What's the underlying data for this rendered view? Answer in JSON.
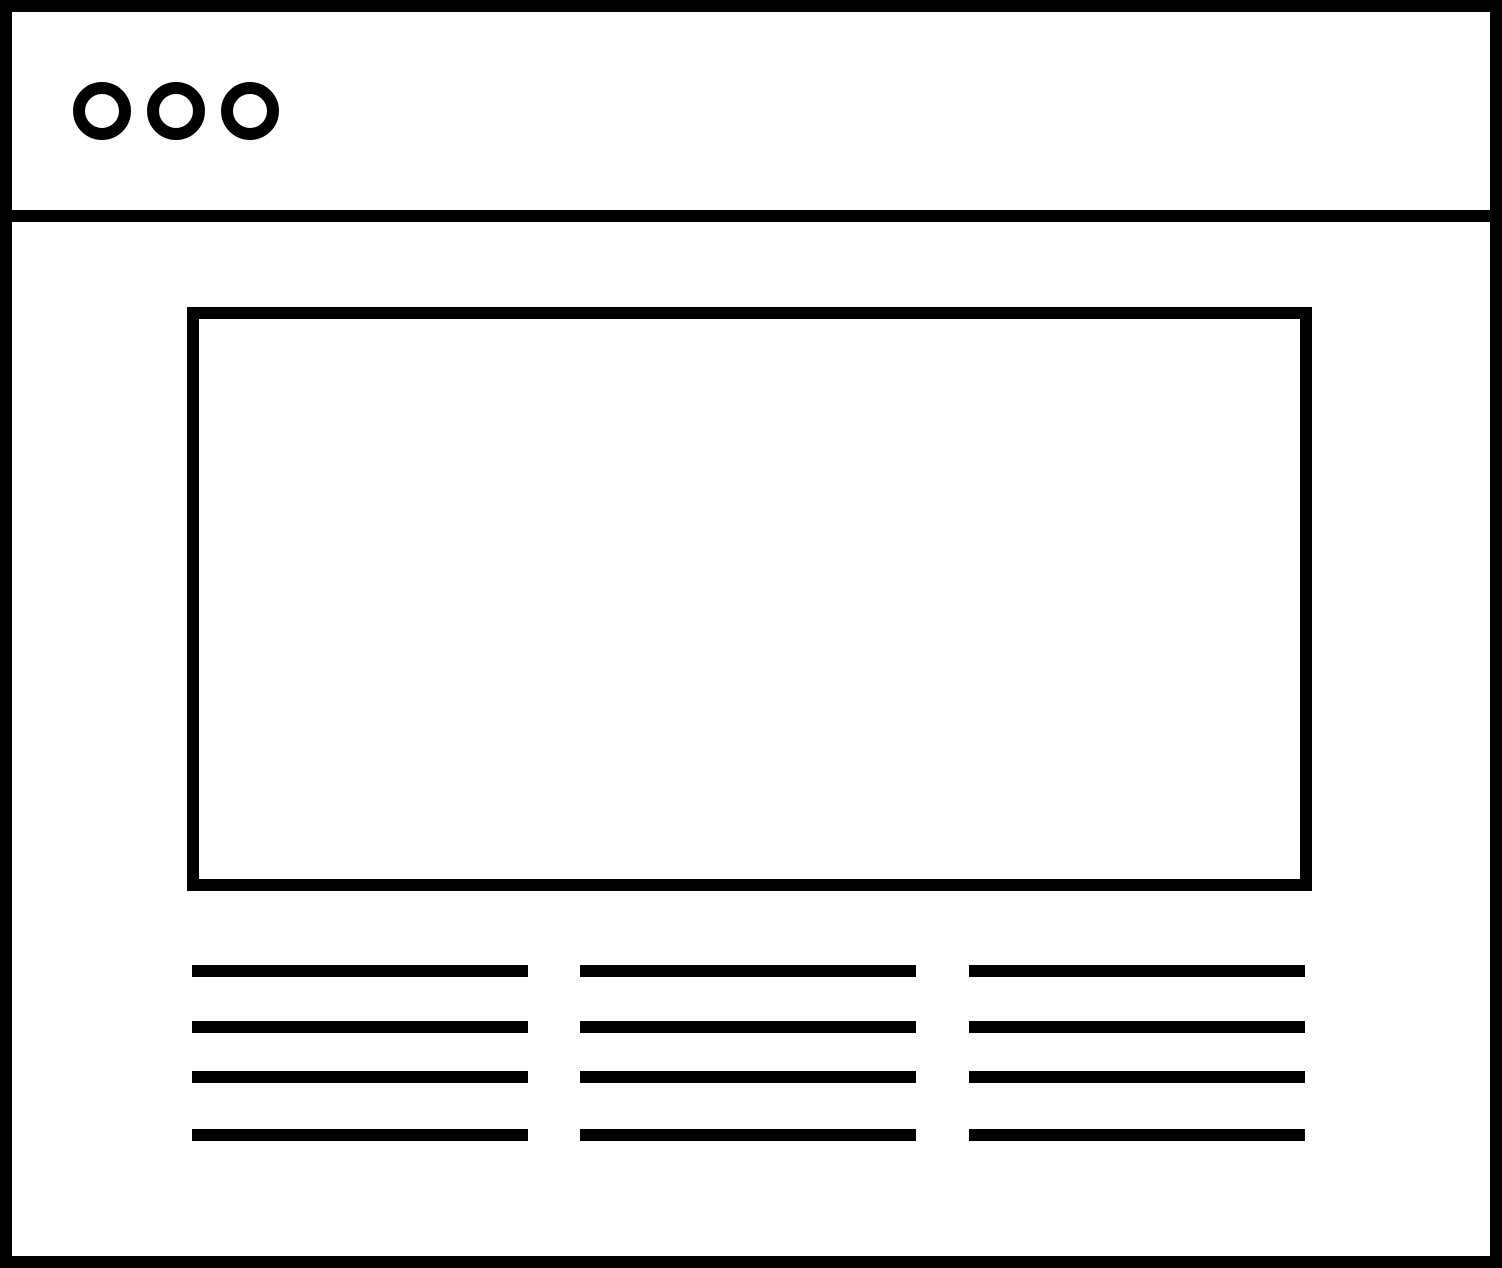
{
  "window": {
    "title_bar_controls": [
      {
        "icon": "circle-outline-icon"
      },
      {
        "icon": "circle-outline-icon"
      },
      {
        "icon": "circle-outline-icon"
      }
    ]
  },
  "content": {
    "hero_placeholder": {
      "icon": "image-placeholder"
    },
    "text_columns": [
      {
        "line_count": 4
      },
      {
        "line_count": 4
      },
      {
        "line_count": 4
      }
    ]
  },
  "colors": {
    "stroke": "#000000",
    "background": "#ffffff"
  }
}
